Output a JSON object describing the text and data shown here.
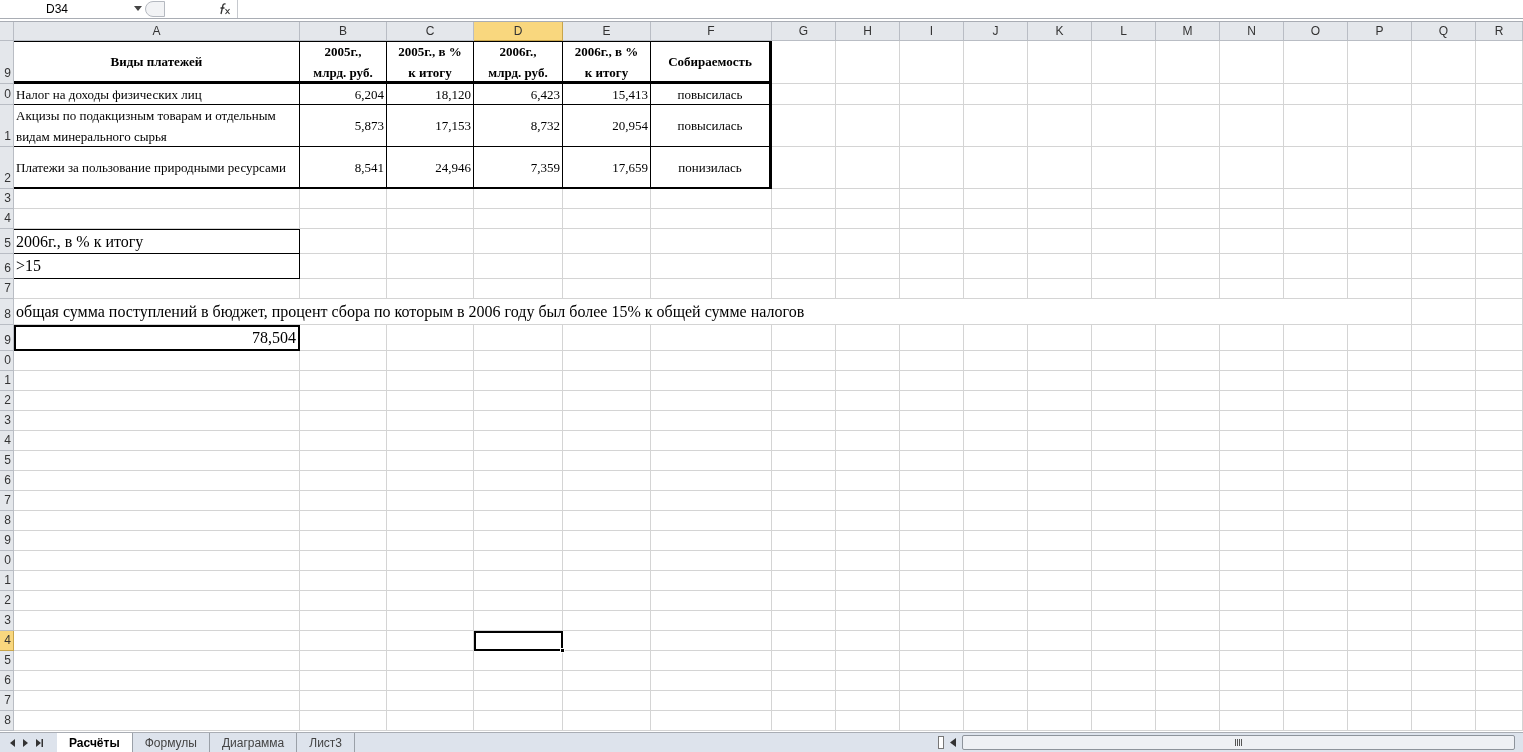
{
  "name_box": "D34",
  "columns": [
    {
      "label": "A",
      "selected": false
    },
    {
      "label": "B",
      "selected": false
    },
    {
      "label": "C",
      "selected": false
    },
    {
      "label": "D",
      "selected": true
    },
    {
      "label": "E",
      "selected": false
    },
    {
      "label": "F",
      "selected": false
    },
    {
      "label": "G",
      "selected": false
    },
    {
      "label": "H",
      "selected": false
    },
    {
      "label": "I",
      "selected": false
    },
    {
      "label": "J",
      "selected": false
    },
    {
      "label": "K",
      "selected": false
    },
    {
      "label": "L",
      "selected": false
    },
    {
      "label": "M",
      "selected": false
    },
    {
      "label": "N",
      "selected": false
    },
    {
      "label": "O",
      "selected": false
    },
    {
      "label": "P",
      "selected": false
    },
    {
      "label": "Q",
      "selected": false
    },
    {
      "label": "R",
      "selected": false
    }
  ],
  "rows": [
    {
      "label": "9",
      "selected": false
    },
    {
      "label": "0",
      "selected": false
    },
    {
      "label": "1",
      "selected": false
    },
    {
      "label": "2",
      "selected": false
    },
    {
      "label": "3",
      "selected": false
    },
    {
      "label": "4",
      "selected": false
    },
    {
      "label": "5",
      "selected": false
    },
    {
      "label": "6",
      "selected": false
    },
    {
      "label": "7",
      "selected": false
    },
    {
      "label": "8",
      "selected": false
    },
    {
      "label": "9",
      "selected": false
    },
    {
      "label": "0",
      "selected": false
    },
    {
      "label": "1",
      "selected": false
    },
    {
      "label": "2",
      "selected": false
    },
    {
      "label": "3",
      "selected": false
    },
    {
      "label": "4",
      "selected": false
    },
    {
      "label": "5",
      "selected": false
    },
    {
      "label": "6",
      "selected": false
    },
    {
      "label": "7",
      "selected": false
    },
    {
      "label": "8",
      "selected": false
    },
    {
      "label": "9",
      "selected": false
    },
    {
      "label": "0",
      "selected": false
    },
    {
      "label": "1",
      "selected": false
    },
    {
      "label": "2",
      "selected": false
    },
    {
      "label": "3",
      "selected": false
    },
    {
      "label": "4",
      "selected": true
    },
    {
      "label": "5",
      "selected": false
    },
    {
      "label": "6",
      "selected": false
    },
    {
      "label": "7",
      "selected": false
    },
    {
      "label": "8",
      "selected": false
    }
  ],
  "table": {
    "headings": [
      "Виды платежей",
      "2005г.,\nмлрд. руб.",
      "2005г., в %\nк итогу",
      "2006г.,\nмлрд. руб.",
      "2006г., в %\nк итогу",
      "Собираемость"
    ],
    "rows": [
      [
        "Налог на доходы физических лиц",
        "6,204",
        "18,120",
        "6,423",
        "15,413",
        "повысилась"
      ],
      [
        "Акцизы по подакцизным товарам и отдельным видам минерального сырья",
        "5,873",
        "17,153",
        "8,732",
        "20,954",
        "повысилась"
      ],
      [
        "Платежи за пользование природными ресурсами",
        "8,541",
        "24,946",
        "7,359",
        "17,659",
        "понизилась"
      ]
    ]
  },
  "criteria": [
    "2006г., в % к итогу",
    ">15"
  ],
  "note": "общая сумма поступлений в бюджет, процент сбора по которым в 2006 году был более 15% к общей сумме налогов",
  "result": "78,504",
  "sheet_tabs": [
    {
      "label": "Расчёты",
      "selected": true
    },
    {
      "label": "Формулы",
      "selected": false
    },
    {
      "label": "Диаграмма",
      "selected": false
    },
    {
      "label": "Лист3",
      "selected": false
    }
  ]
}
